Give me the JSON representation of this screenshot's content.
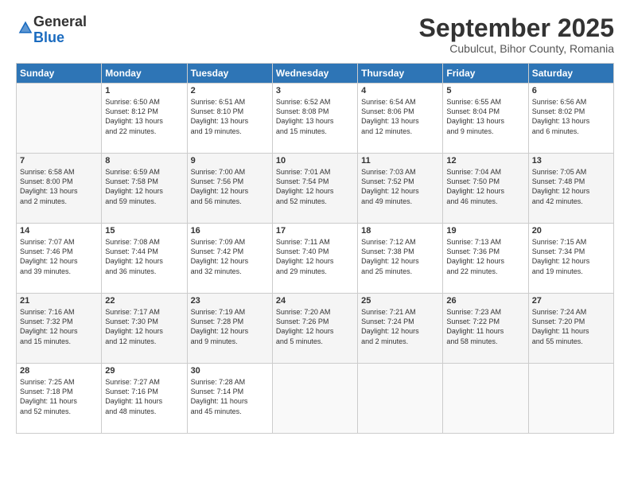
{
  "logo": {
    "general": "General",
    "blue": "Blue"
  },
  "header": {
    "month": "September 2025",
    "location": "Cubulcut, Bihor County, Romania"
  },
  "weekdays": [
    "Sunday",
    "Monday",
    "Tuesday",
    "Wednesday",
    "Thursday",
    "Friday",
    "Saturday"
  ],
  "weeks": [
    [
      {
        "day": "",
        "info": ""
      },
      {
        "day": "1",
        "info": "Sunrise: 6:50 AM\nSunset: 8:12 PM\nDaylight: 13 hours\nand 22 minutes."
      },
      {
        "day": "2",
        "info": "Sunrise: 6:51 AM\nSunset: 8:10 PM\nDaylight: 13 hours\nand 19 minutes."
      },
      {
        "day": "3",
        "info": "Sunrise: 6:52 AM\nSunset: 8:08 PM\nDaylight: 13 hours\nand 15 minutes."
      },
      {
        "day": "4",
        "info": "Sunrise: 6:54 AM\nSunset: 8:06 PM\nDaylight: 13 hours\nand 12 minutes."
      },
      {
        "day": "5",
        "info": "Sunrise: 6:55 AM\nSunset: 8:04 PM\nDaylight: 13 hours\nand 9 minutes."
      },
      {
        "day": "6",
        "info": "Sunrise: 6:56 AM\nSunset: 8:02 PM\nDaylight: 13 hours\nand 6 minutes."
      }
    ],
    [
      {
        "day": "7",
        "info": "Sunrise: 6:58 AM\nSunset: 8:00 PM\nDaylight: 13 hours\nand 2 minutes."
      },
      {
        "day": "8",
        "info": "Sunrise: 6:59 AM\nSunset: 7:58 PM\nDaylight: 12 hours\nand 59 minutes."
      },
      {
        "day": "9",
        "info": "Sunrise: 7:00 AM\nSunset: 7:56 PM\nDaylight: 12 hours\nand 56 minutes."
      },
      {
        "day": "10",
        "info": "Sunrise: 7:01 AM\nSunset: 7:54 PM\nDaylight: 12 hours\nand 52 minutes."
      },
      {
        "day": "11",
        "info": "Sunrise: 7:03 AM\nSunset: 7:52 PM\nDaylight: 12 hours\nand 49 minutes."
      },
      {
        "day": "12",
        "info": "Sunrise: 7:04 AM\nSunset: 7:50 PM\nDaylight: 12 hours\nand 46 minutes."
      },
      {
        "day": "13",
        "info": "Sunrise: 7:05 AM\nSunset: 7:48 PM\nDaylight: 12 hours\nand 42 minutes."
      }
    ],
    [
      {
        "day": "14",
        "info": "Sunrise: 7:07 AM\nSunset: 7:46 PM\nDaylight: 12 hours\nand 39 minutes."
      },
      {
        "day": "15",
        "info": "Sunrise: 7:08 AM\nSunset: 7:44 PM\nDaylight: 12 hours\nand 36 minutes."
      },
      {
        "day": "16",
        "info": "Sunrise: 7:09 AM\nSunset: 7:42 PM\nDaylight: 12 hours\nand 32 minutes."
      },
      {
        "day": "17",
        "info": "Sunrise: 7:11 AM\nSunset: 7:40 PM\nDaylight: 12 hours\nand 29 minutes."
      },
      {
        "day": "18",
        "info": "Sunrise: 7:12 AM\nSunset: 7:38 PM\nDaylight: 12 hours\nand 25 minutes."
      },
      {
        "day": "19",
        "info": "Sunrise: 7:13 AM\nSunset: 7:36 PM\nDaylight: 12 hours\nand 22 minutes."
      },
      {
        "day": "20",
        "info": "Sunrise: 7:15 AM\nSunset: 7:34 PM\nDaylight: 12 hours\nand 19 minutes."
      }
    ],
    [
      {
        "day": "21",
        "info": "Sunrise: 7:16 AM\nSunset: 7:32 PM\nDaylight: 12 hours\nand 15 minutes."
      },
      {
        "day": "22",
        "info": "Sunrise: 7:17 AM\nSunset: 7:30 PM\nDaylight: 12 hours\nand 12 minutes."
      },
      {
        "day": "23",
        "info": "Sunrise: 7:19 AM\nSunset: 7:28 PM\nDaylight: 12 hours\nand 9 minutes."
      },
      {
        "day": "24",
        "info": "Sunrise: 7:20 AM\nSunset: 7:26 PM\nDaylight: 12 hours\nand 5 minutes."
      },
      {
        "day": "25",
        "info": "Sunrise: 7:21 AM\nSunset: 7:24 PM\nDaylight: 12 hours\nand 2 minutes."
      },
      {
        "day": "26",
        "info": "Sunrise: 7:23 AM\nSunset: 7:22 PM\nDaylight: 11 hours\nand 58 minutes."
      },
      {
        "day": "27",
        "info": "Sunrise: 7:24 AM\nSunset: 7:20 PM\nDaylight: 11 hours\nand 55 minutes."
      }
    ],
    [
      {
        "day": "28",
        "info": "Sunrise: 7:25 AM\nSunset: 7:18 PM\nDaylight: 11 hours\nand 52 minutes."
      },
      {
        "day": "29",
        "info": "Sunrise: 7:27 AM\nSunset: 7:16 PM\nDaylight: 11 hours\nand 48 minutes."
      },
      {
        "day": "30",
        "info": "Sunrise: 7:28 AM\nSunset: 7:14 PM\nDaylight: 11 hours\nand 45 minutes."
      },
      {
        "day": "",
        "info": ""
      },
      {
        "day": "",
        "info": ""
      },
      {
        "day": "",
        "info": ""
      },
      {
        "day": "",
        "info": ""
      }
    ]
  ]
}
